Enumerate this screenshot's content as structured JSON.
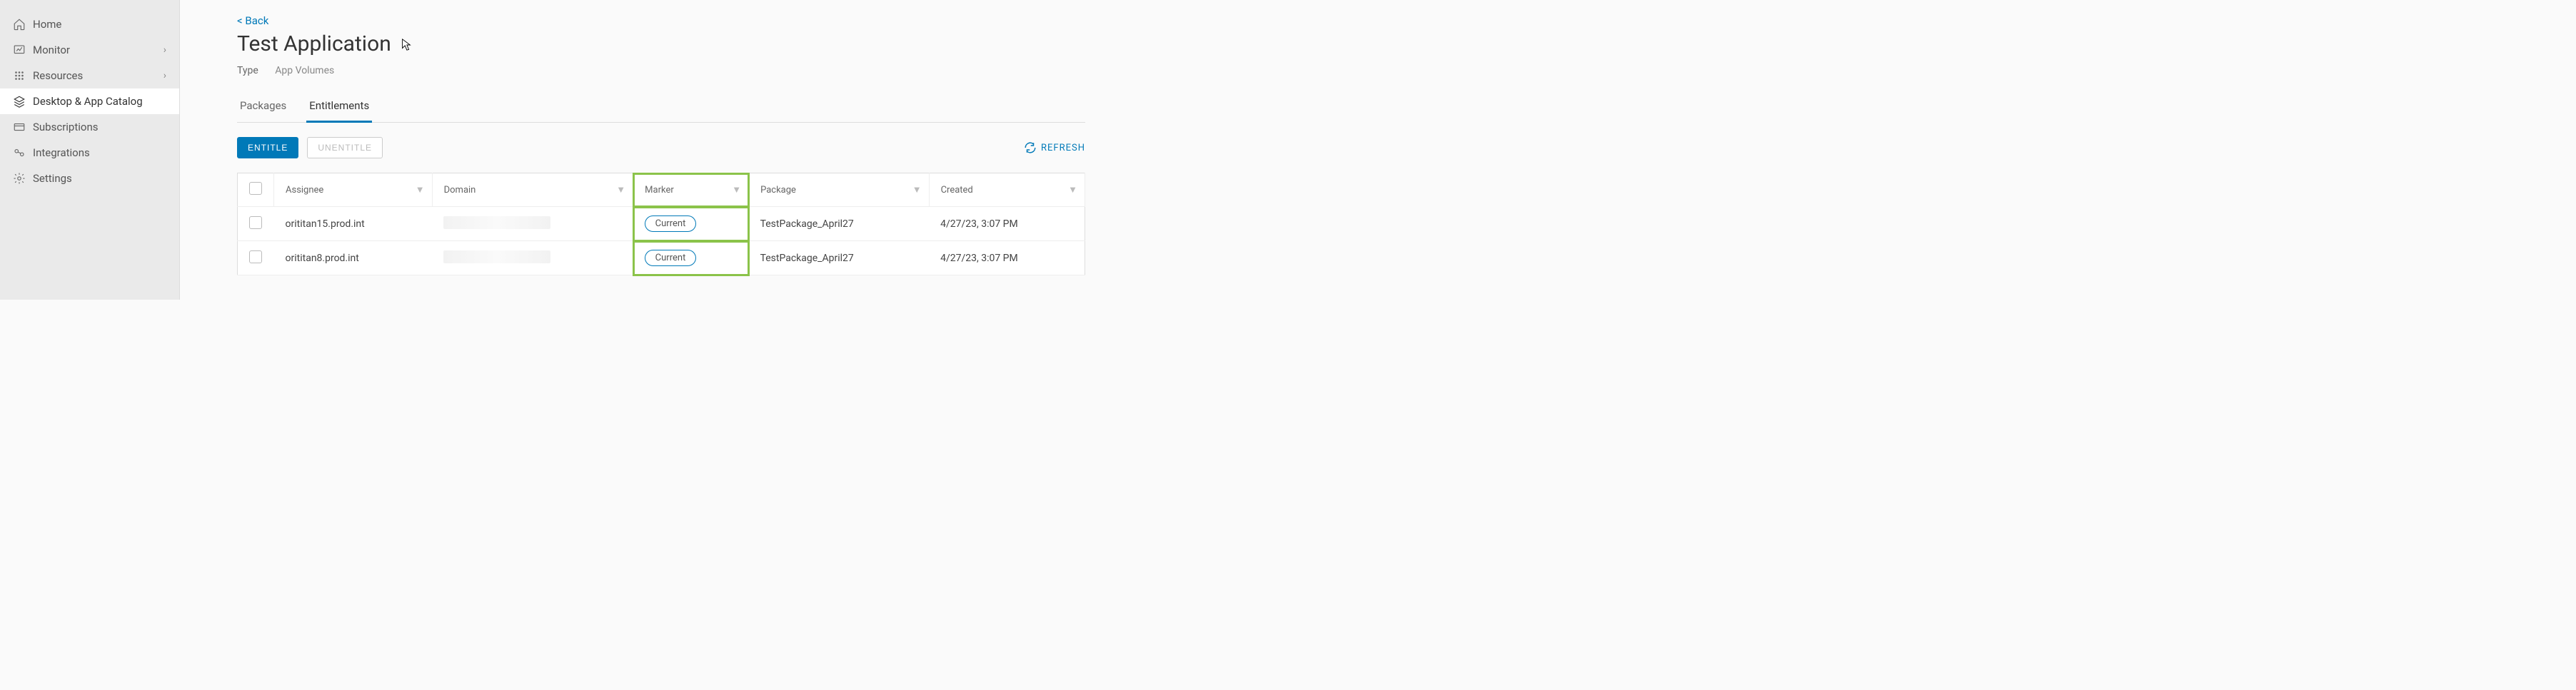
{
  "sidebar": {
    "items": [
      {
        "icon": "home",
        "label": "Home",
        "expandable": false
      },
      {
        "icon": "monitor",
        "label": "Monitor",
        "expandable": true
      },
      {
        "icon": "resources",
        "label": "Resources",
        "expandable": true
      },
      {
        "icon": "catalog",
        "label": "Desktop & App Catalog",
        "expandable": false,
        "active": true
      },
      {
        "icon": "subscriptions",
        "label": "Subscriptions",
        "expandable": false
      },
      {
        "icon": "integrations",
        "label": "Integrations",
        "expandable": false
      },
      {
        "icon": "settings",
        "label": "Settings",
        "expandable": false
      }
    ]
  },
  "header": {
    "back_label": "< Back",
    "title": "Test Application",
    "type_label": "Type",
    "type_value": "App Volumes"
  },
  "tabs": [
    {
      "label": "Packages",
      "active": false
    },
    {
      "label": "Entitlements",
      "active": true
    }
  ],
  "actions": {
    "entitle": "ENTITLE",
    "unentitle": "UNENTITLE",
    "refresh": "REFRESH"
  },
  "table": {
    "columns": [
      "Assignee",
      "Domain",
      "Marker",
      "Package",
      "Created"
    ],
    "rows": [
      {
        "assignee": "orititan15.prod.int",
        "domain": "",
        "marker": "Current",
        "package": "TestPackage_April27",
        "created": "4/27/23, 3:07 PM"
      },
      {
        "assignee": "orititan8.prod.int",
        "domain": "",
        "marker": "Current",
        "package": "TestPackage_April27",
        "created": "4/27/23, 3:07 PM"
      }
    ]
  }
}
